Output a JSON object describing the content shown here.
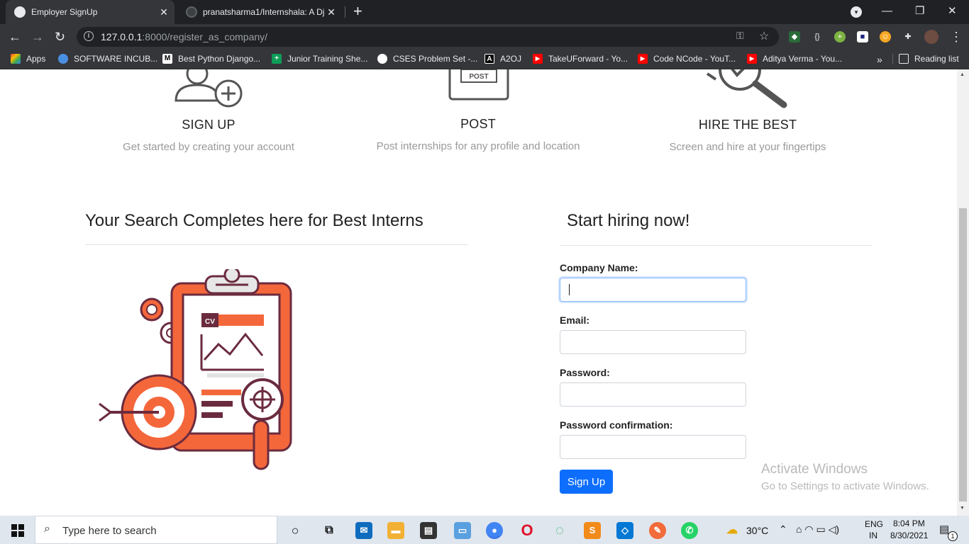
{
  "browser": {
    "tabs": [
      {
        "title": "Employer SignUp",
        "active": true
      },
      {
        "title": "pranatsharma1/Internshala: A Dja",
        "active": false
      }
    ],
    "url_host": "127.0.0.1",
    "url_rest": ":8000/register_as_company/",
    "bookmarks": [
      {
        "label": "Apps",
        "icon": "apps-grid-icon",
        "color": "#ea4335"
      },
      {
        "label": "SOFTWARE INCUB...",
        "icon": "software-incubator-icon",
        "color": "#4a90e2"
      },
      {
        "label": "Best Python Django...",
        "icon": "medium-icon",
        "color": "#000000"
      },
      {
        "label": "Junior Training She...",
        "icon": "sheets-icon",
        "color": "#0f9d58"
      },
      {
        "label": "CSES Problem Set -...",
        "icon": "cses-icon",
        "color": "#ffffff"
      },
      {
        "label": "A2OJ",
        "icon": "a2oj-icon",
        "color": "#000000"
      },
      {
        "label": "TakeUForward - Yo...",
        "icon": "youtube-icon",
        "color": "#ff0000"
      },
      {
        "label": "Code NCode - YouT...",
        "icon": "youtube-icon",
        "color": "#ff0000"
      },
      {
        "label": "Aditya Verma - You...",
        "icon": "youtube-icon",
        "color": "#ff0000"
      }
    ],
    "reading_list": "Reading list"
  },
  "features": [
    {
      "title": "SIGN UP",
      "desc": "Get started by creating your account",
      "icon": "user-plus-icon"
    },
    {
      "title": "POST",
      "desc": "Post internships for any profile and location",
      "icon": "post-box-icon"
    },
    {
      "title": "HIRE THE BEST",
      "desc": "Screen and hire at your fingertips",
      "icon": "magnifier-icon"
    }
  ],
  "left_heading": "Your Search Completes here for Best Interns",
  "illustration_badge": "CV",
  "form": {
    "heading": "Start hiring now!",
    "company_label": "Company Name:",
    "email_label": "Email:",
    "password_label": "Password:",
    "password_confirm_label": "Password confirmation:",
    "submit_label": "Sign Up",
    "company_value": "",
    "email_value": "",
    "password_value": "",
    "password_confirm_value": ""
  },
  "watermark": {
    "line1": "Activate Windows",
    "line2": "Go to Settings to activate Windows."
  },
  "taskbar": {
    "search_placeholder": "Type here to search",
    "weather": "30°C",
    "language_top": "ENG",
    "language_bottom": "IN",
    "time": "8:04 PM",
    "date": "8/30/2021",
    "notification_count": "1"
  },
  "colors": {
    "primary_button": "#0d6efd",
    "illustration_orange": "#f4673b",
    "illustration_maroon": "#6b2b3e"
  }
}
